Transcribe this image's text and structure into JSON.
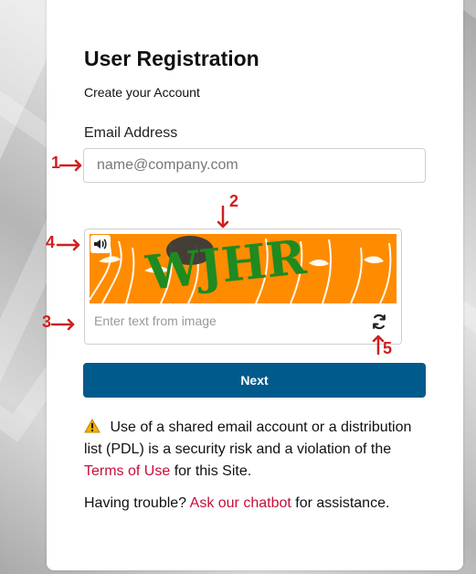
{
  "form": {
    "title": "User Registration",
    "subtitle": "Create your Account",
    "email_label": "Email Address",
    "email_placeholder": "name@company.com",
    "captcha_placeholder": "Enter text from image",
    "next_label": "Next"
  },
  "captcha": {
    "text": "WJHR",
    "background": "#ff8c00",
    "text_color": "#1f8a20"
  },
  "notice": {
    "text_1": "Use of a shared email account or a distribution list (PDL) is a security risk and a violation of the ",
    "link": "Terms of Use",
    "text_2": " for this Site."
  },
  "help": {
    "prefix": "Having trouble? ",
    "link": "Ask our chatbot",
    "suffix": " for assistance."
  },
  "annotations": [
    "1",
    "2",
    "3",
    "4",
    "5"
  ],
  "colors": {
    "primary_button": "#005a8c",
    "link": "#c4103a",
    "annotation": "#cf1f1f"
  }
}
